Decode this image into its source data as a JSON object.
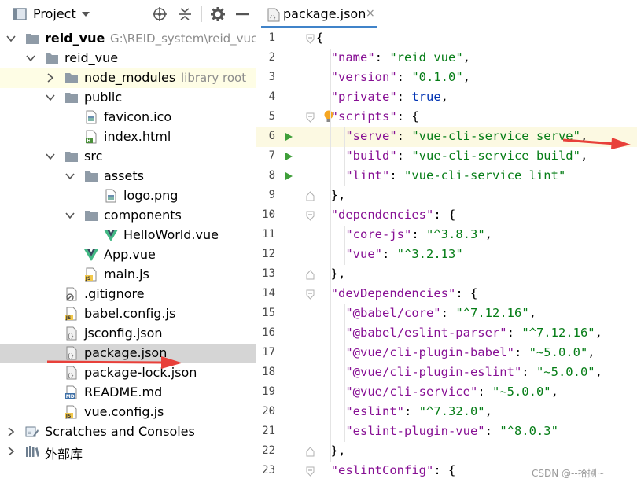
{
  "project_panel": {
    "title": "Project",
    "tree": [
      {
        "label": "reid_vue",
        "secondary": "G:\\REID_system\\reid_vue",
        "icon": "folder-icon",
        "expanded": true,
        "bold": true
      },
      {
        "label": "reid_vue",
        "icon": "folder-icon",
        "expanded": true
      },
      {
        "label": "node_modules",
        "secondary": "library root",
        "icon": "folder-icon",
        "expanded": false
      },
      {
        "label": "public",
        "icon": "folder-icon",
        "expanded": true
      },
      {
        "label": "favicon.ico",
        "icon": "image-file-icon"
      },
      {
        "label": "index.html",
        "icon": "html-file-icon"
      },
      {
        "label": "src",
        "icon": "folder-icon",
        "expanded": true
      },
      {
        "label": "assets",
        "icon": "folder-icon",
        "expanded": true
      },
      {
        "label": "logo.png",
        "icon": "image-file-icon"
      },
      {
        "label": "components",
        "icon": "folder-icon",
        "expanded": true
      },
      {
        "label": "HelloWorld.vue",
        "icon": "vue-file-icon"
      },
      {
        "label": "App.vue",
        "icon": "vue-file-icon"
      },
      {
        "label": "main.js",
        "icon": "js-file-icon"
      },
      {
        "label": ".gitignore",
        "icon": "gitignore-file-icon"
      },
      {
        "label": "babel.config.js",
        "icon": "js-file-icon"
      },
      {
        "label": "jsconfig.json",
        "icon": "json-file-icon"
      },
      {
        "label": "package.json",
        "icon": "json-file-icon",
        "selected": true
      },
      {
        "label": "package-lock.json",
        "icon": "json-file-icon"
      },
      {
        "label": "README.md",
        "icon": "markdown-file-icon"
      },
      {
        "label": "vue.config.js",
        "icon": "js-file-icon"
      },
      {
        "label": "Scratches and Consoles",
        "icon": "scratches-icon",
        "expanded": false
      },
      {
        "label": "外部库",
        "icon": "library-icon",
        "expanded": false
      }
    ]
  },
  "editor": {
    "tab_label": "package.json",
    "tab_close": "×",
    "lines": [
      {
        "num": "1",
        "tokens": [
          {
            "t": "{",
            "c": "p"
          }
        ]
      },
      {
        "num": "2",
        "tokens": [
          {
            "t": "  ",
            "c": "p"
          },
          {
            "t": "\"name\"",
            "c": "k"
          },
          {
            "t": ": ",
            "c": "p"
          },
          {
            "t": "\"reid_vue\"",
            "c": "s"
          },
          {
            "t": ",",
            "c": "p"
          }
        ]
      },
      {
        "num": "3",
        "tokens": [
          {
            "t": "  ",
            "c": "p"
          },
          {
            "t": "\"version\"",
            "c": "k"
          },
          {
            "t": ": ",
            "c": "p"
          },
          {
            "t": "\"0.1.0\"",
            "c": "s"
          },
          {
            "t": ",",
            "c": "p"
          }
        ]
      },
      {
        "num": "4",
        "tokens": [
          {
            "t": "  ",
            "c": "p"
          },
          {
            "t": "\"private\"",
            "c": "k"
          },
          {
            "t": ": ",
            "c": "p"
          },
          {
            "t": "true",
            "c": "b"
          },
          {
            "t": ",",
            "c": "p"
          }
        ]
      },
      {
        "num": "5",
        "tokens": [
          {
            "t": "  ",
            "c": "p"
          },
          {
            "t": "\"scripts\"",
            "c": "k"
          },
          {
            "t": ": {",
            "c": "p"
          }
        ]
      },
      {
        "num": "6",
        "tokens": [
          {
            "t": "    ",
            "c": "p"
          },
          {
            "t": "\"serve\"",
            "c": "k"
          },
          {
            "t": ": ",
            "c": "p"
          },
          {
            "t": "\"vue-cli-service serve\"",
            "c": "s"
          },
          {
            "t": ",",
            "c": "p"
          }
        ]
      },
      {
        "num": "7",
        "tokens": [
          {
            "t": "    ",
            "c": "p"
          },
          {
            "t": "\"build\"",
            "c": "k"
          },
          {
            "t": ": ",
            "c": "p"
          },
          {
            "t": "\"vue-cli-service build\"",
            "c": "s"
          },
          {
            "t": ",",
            "c": "p"
          }
        ]
      },
      {
        "num": "8",
        "tokens": [
          {
            "t": "    ",
            "c": "p"
          },
          {
            "t": "\"lint\"",
            "c": "k"
          },
          {
            "t": ": ",
            "c": "p"
          },
          {
            "t": "\"vue-cli-service lint\"",
            "c": "s"
          }
        ]
      },
      {
        "num": "9",
        "tokens": [
          {
            "t": "  },",
            "c": "p"
          }
        ]
      },
      {
        "num": "10",
        "tokens": [
          {
            "t": "  ",
            "c": "p"
          },
          {
            "t": "\"dependencies\"",
            "c": "k"
          },
          {
            "t": ": {",
            "c": "p"
          }
        ]
      },
      {
        "num": "11",
        "tokens": [
          {
            "t": "    ",
            "c": "p"
          },
          {
            "t": "\"core-js\"",
            "c": "k"
          },
          {
            "t": ": ",
            "c": "p"
          },
          {
            "t": "\"^3.8.3\"",
            "c": "s"
          },
          {
            "t": ",",
            "c": "p"
          }
        ]
      },
      {
        "num": "12",
        "tokens": [
          {
            "t": "    ",
            "c": "p"
          },
          {
            "t": "\"vue\"",
            "c": "k"
          },
          {
            "t": ": ",
            "c": "p"
          },
          {
            "t": "\"^3.2.13\"",
            "c": "s"
          }
        ]
      },
      {
        "num": "13",
        "tokens": [
          {
            "t": "  },",
            "c": "p"
          }
        ]
      },
      {
        "num": "14",
        "tokens": [
          {
            "t": "  ",
            "c": "p"
          },
          {
            "t": "\"devDependencies\"",
            "c": "k"
          },
          {
            "t": ": {",
            "c": "p"
          }
        ]
      },
      {
        "num": "15",
        "tokens": [
          {
            "t": "    ",
            "c": "p"
          },
          {
            "t": "\"@babel/core\"",
            "c": "k"
          },
          {
            "t": ": ",
            "c": "p"
          },
          {
            "t": "\"^7.12.16\"",
            "c": "s"
          },
          {
            "t": ",",
            "c": "p"
          }
        ]
      },
      {
        "num": "16",
        "tokens": [
          {
            "t": "    ",
            "c": "p"
          },
          {
            "t": "\"@babel/eslint-parser\"",
            "c": "k"
          },
          {
            "t": ": ",
            "c": "p"
          },
          {
            "t": "\"^7.12.16\"",
            "c": "s"
          },
          {
            "t": ",",
            "c": "p"
          }
        ]
      },
      {
        "num": "17",
        "tokens": [
          {
            "t": "    ",
            "c": "p"
          },
          {
            "t": "\"@vue/cli-plugin-babel\"",
            "c": "k"
          },
          {
            "t": ": ",
            "c": "p"
          },
          {
            "t": "\"~5.0.0\"",
            "c": "s"
          },
          {
            "t": ",",
            "c": "p"
          }
        ]
      },
      {
        "num": "18",
        "tokens": [
          {
            "t": "    ",
            "c": "p"
          },
          {
            "t": "\"@vue/cli-plugin-eslint\"",
            "c": "k"
          },
          {
            "t": ": ",
            "c": "p"
          },
          {
            "t": "\"~5.0.0\"",
            "c": "s"
          },
          {
            "t": ",",
            "c": "p"
          }
        ]
      },
      {
        "num": "19",
        "tokens": [
          {
            "t": "    ",
            "c": "p"
          },
          {
            "t": "\"@vue/cli-service\"",
            "c": "k"
          },
          {
            "t": ": ",
            "c": "p"
          },
          {
            "t": "\"~5.0.0\"",
            "c": "s"
          },
          {
            "t": ",",
            "c": "p"
          }
        ]
      },
      {
        "num": "20",
        "tokens": [
          {
            "t": "    ",
            "c": "p"
          },
          {
            "t": "\"eslint\"",
            "c": "k"
          },
          {
            "t": ": ",
            "c": "p"
          },
          {
            "t": "\"^7.32.0\"",
            "c": "s"
          },
          {
            "t": ",",
            "c": "p"
          }
        ]
      },
      {
        "num": "21",
        "tokens": [
          {
            "t": "    ",
            "c": "p"
          },
          {
            "t": "\"eslint-plugin-vue\"",
            "c": "k"
          },
          {
            "t": ": ",
            "c": "p"
          },
          {
            "t": "\"^8.0.3\"",
            "c": "s"
          }
        ]
      },
      {
        "num": "22",
        "tokens": [
          {
            "t": "  },",
            "c": "p"
          }
        ]
      },
      {
        "num": "23",
        "tokens": [
          {
            "t": "  ",
            "c": "p"
          },
          {
            "t": "\"eslintConfig\"",
            "c": "k"
          },
          {
            "t": ": {",
            "c": "p"
          }
        ]
      }
    ]
  },
  "watermark": "CSDN @--拾捌~",
  "colors": {
    "arrow": "#e8403a",
    "run": "#3f9f3a",
    "folder": "#8f9ba7",
    "key": "#871094",
    "string": "#067d17",
    "keyword": "#0033b3",
    "selected_row": "#d5d5d5",
    "highlight_row": "#fcf9e2"
  }
}
